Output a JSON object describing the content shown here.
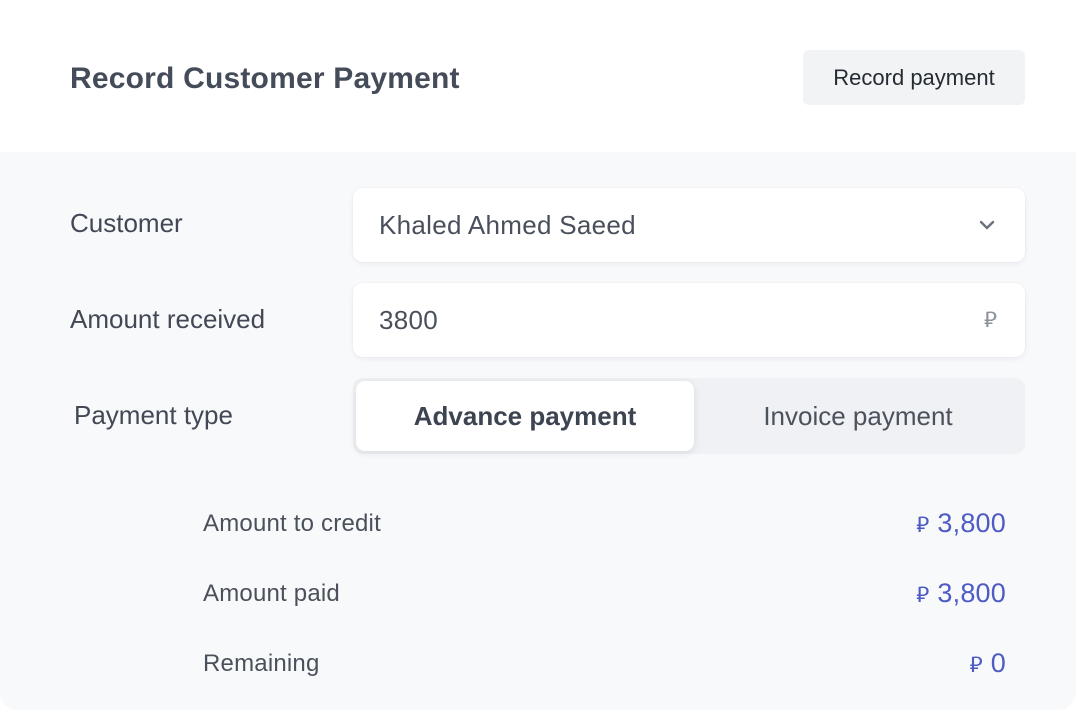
{
  "title": "Record Customer Payment",
  "record_button": "Record payment",
  "customer": {
    "label": "Customer",
    "value": "Khaled Ahmed Saeed"
  },
  "amount": {
    "label": "Amount received",
    "value": "3800",
    "currency_symbol": "⃁"
  },
  "payment_type": {
    "label": "Payment type",
    "options": [
      "Advance payment",
      "Invoice payment"
    ],
    "selected": "Advance payment"
  },
  "summary": [
    {
      "label": "Amount to credit",
      "currency_symbol": "⃁",
      "value": "3,800"
    },
    {
      "label": "Amount paid",
      "currency_symbol": "⃁",
      "value": "3,800"
    },
    {
      "label": "Remaining",
      "currency_symbol": "⃁",
      "value": "0"
    }
  ],
  "colors": {
    "accent": "#4e5bc4",
    "text": "#424955",
    "panel_bg": "#f8f9fb"
  }
}
